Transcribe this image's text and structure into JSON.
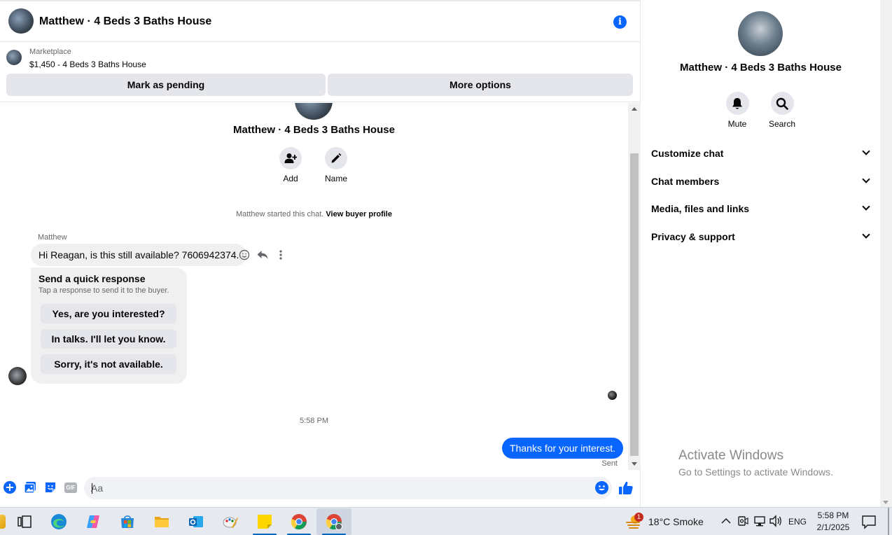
{
  "chat": {
    "header_title": "Matthew · 4 Beds 3 Baths House",
    "listing_label": "Marketplace",
    "listing_price": "$1,450 - 4 Beds 3 Baths House",
    "btn_pending": "Mark as pending",
    "btn_more": "More options",
    "intro_title": "Matthew · 4 Beds 3 Baths House",
    "intro_add": "Add",
    "intro_name": "Name",
    "started_prefix": "Matthew started this chat.",
    "started_link": "View buyer profile",
    "sender_name": "Matthew",
    "incoming_message": "Hi Reagan, is this still available? 7606942374.",
    "quick_title": "Send a quick response",
    "quick_subtitle": "Tap a response to send it to the buyer.",
    "quick_responses": [
      "Yes, are you interested?",
      "In talks. I'll let you know.",
      "Sorry, it's not available."
    ],
    "timestamp": "5:58 PM",
    "outgoing_message": "Thanks for your interest.",
    "sent_status": "Sent",
    "composer_placeholder": "Aa",
    "gif_label": "GIF"
  },
  "sidebar": {
    "title": "Matthew · 4 Beds 3 Baths House",
    "mute": "Mute",
    "search": "Search",
    "items": [
      "Customize chat",
      "Chat members",
      "Media, files and links",
      "Privacy & support"
    ]
  },
  "watermark": {
    "line1": "Activate Windows",
    "line2": "Go to Settings to activate Windows."
  },
  "taskbar": {
    "weather": "18°C  Smoke",
    "language": "ENG",
    "time": "5:58 PM",
    "date": "2/1/2025",
    "notification_count": "1"
  },
  "colors": {
    "accent": "#0866ff",
    "bubble_in": "#f0f0f0",
    "button_bg": "#e4e6eb"
  }
}
